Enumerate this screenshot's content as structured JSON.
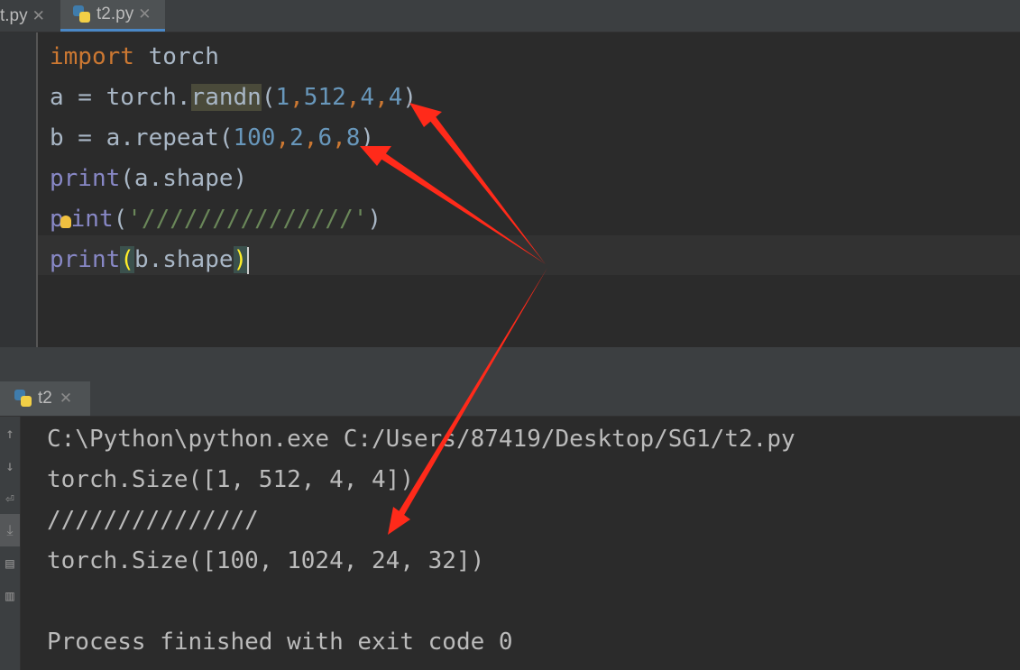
{
  "tabs": [
    {
      "label": "t.py",
      "active": false
    },
    {
      "label": "t2.py",
      "active": true
    }
  ],
  "run_tab": {
    "label": "t2"
  },
  "editor": {
    "line1": {
      "kw": "import",
      "rest": " torch"
    },
    "line2": {
      "pre": "a = torch.",
      "fn": "randn",
      "open": "(",
      "n1": "1",
      "c1": ",",
      "n2": "512",
      "c2": ",",
      "n3": "4",
      "c3": ",",
      "n4": "4",
      "close": ")"
    },
    "line3": {
      "pre": "b = a.repeat(",
      "n1": "100",
      "c1": ",",
      "n2": "2",
      "c2": ",",
      "n3": "6",
      "c3": ",",
      "n4": "8",
      "close": ")"
    },
    "line4": {
      "fn": "print",
      "rest": "(a.shape)"
    },
    "line5": {
      "fn_a": "p",
      "fn_b": "int",
      "open": "(",
      "str": "'///////////////'",
      "close": ")"
    },
    "line6": {
      "fn": "print",
      "open": "(",
      "arg": "b.shape",
      "close": ")"
    }
  },
  "console": {
    "lines": [
      "C:\\Python\\python.exe C:/Users/87419/Desktop/SG1/t2.py",
      "torch.Size([1, 512, 4, 4])",
      "///////////////",
      "torch.Size([100, 1024, 24, 32])",
      "",
      "Process finished with exit code 0"
    ]
  },
  "icons": [
    "python-file-icon",
    "close-icon",
    "up-arrow-icon",
    "down-arrow-icon",
    "soft-wrap-icon",
    "scroll-to-end-icon",
    "print-icon",
    "trash-icon",
    "lightbulb-icon"
  ],
  "colors": {
    "keyword": "#cc7832",
    "number": "#6897bb",
    "builtin": "#8888c6",
    "string": "#6a8759",
    "arrow": "#ff2a1a"
  }
}
